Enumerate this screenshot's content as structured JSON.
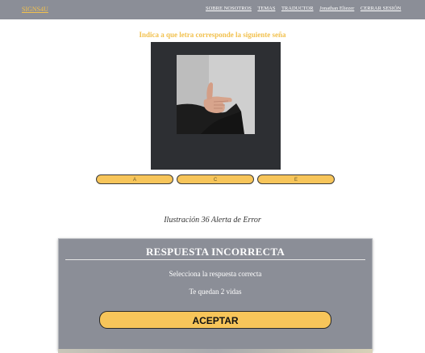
{
  "navbar": {
    "brand": "SIGNS4U",
    "links": [
      "SOBRE NOSOTROS",
      "TEMAS",
      "TRADUCTOR",
      "Jonathan Eliezer",
      "CERRAR SESIÓN"
    ]
  },
  "quiz": {
    "prompt": "Indica a que letra corresponde la siguiente seña",
    "image_icon": "hand-sign-photo",
    "options": [
      "A",
      "C",
      "E"
    ]
  },
  "caption": "Ilustración 36 Alerta de Error",
  "alert": {
    "title": "RESPUESTA INCORRECTA",
    "message": "Selecciona la respuesta correcta",
    "lives": "Te quedan 2 vidas",
    "button": "ACEPTAR"
  },
  "colors": {
    "navbar": "#8b8e97",
    "accent": "#f2c14e",
    "button": "#f7c55a",
    "frame": "#2d2f33",
    "alert_bg": "#8b8e97"
  }
}
